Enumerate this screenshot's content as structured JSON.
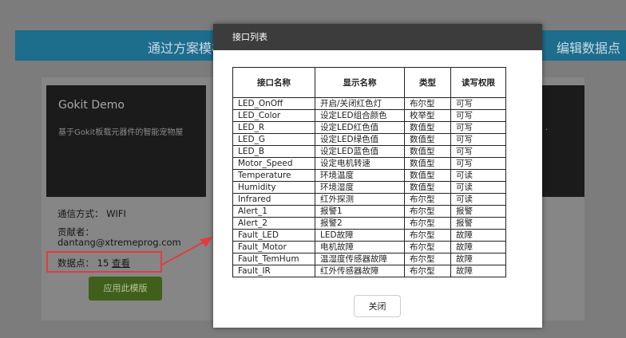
{
  "banner": {
    "left_text": "通过方案模板",
    "right_text": "编辑数据点"
  },
  "card": {
    "title": "Gokit Demo",
    "description": "基于Gokit板载元器件的智能宠物屋"
  },
  "card2": {
    "text": "."
  },
  "info": {
    "comm_label": "通信方式：",
    "comm_value": "WIFI",
    "contributor_label": "贡献者：",
    "contributor_value": "dantang@xtremeprog.com",
    "datapoints_label": "数据点：",
    "datapoints_count": "15",
    "view_link": "查看"
  },
  "apply_button": "应用此模版",
  "modal": {
    "title": "接口列表",
    "headers": [
      "接口名称",
      "显示名称",
      "类型",
      "读写权限"
    ],
    "rows": [
      [
        "LED_OnOff",
        "开启/关闭红色灯",
        "布尔型",
        "可写"
      ],
      [
        "LED_Color",
        "设定LED组合颜色",
        "枚举型",
        "可写"
      ],
      [
        "LED_R",
        "设定LED红色值",
        "数值型",
        "可写"
      ],
      [
        "LED_G",
        "设定LED绿色值",
        "数值型",
        "可写"
      ],
      [
        "LED_B",
        "设定LED蓝色值",
        "数值型",
        "可写"
      ],
      [
        "Motor_Speed",
        "设定电机转速",
        "数值型",
        "可写"
      ],
      [
        "Temperature",
        "环境温度",
        "数值型",
        "可读"
      ],
      [
        "Humidity",
        "环境湿度",
        "数值型",
        "可读"
      ],
      [
        "Infrared",
        "红外探测",
        "布尔型",
        "可读"
      ],
      [
        "Alert_1",
        "报警1",
        "布尔型",
        "报警"
      ],
      [
        "Alert_2",
        "报警2",
        "布尔型",
        "报警"
      ],
      [
        "Fault_LED",
        "LED故障",
        "布尔型",
        "故障"
      ],
      [
        "Fault_Motor",
        "电机故障",
        "布尔型",
        "故障"
      ],
      [
        "Fault_TemHum",
        "温湿度传感器故障",
        "布尔型",
        "故障"
      ],
      [
        "Fault_IR",
        "红外传感器故障",
        "布尔型",
        "故障"
      ]
    ],
    "close_button": "关闭"
  },
  "colors": {
    "highlight": "#e23d3d",
    "banner": "#1d6d8d",
    "apply_button": "#3f5f1a"
  }
}
